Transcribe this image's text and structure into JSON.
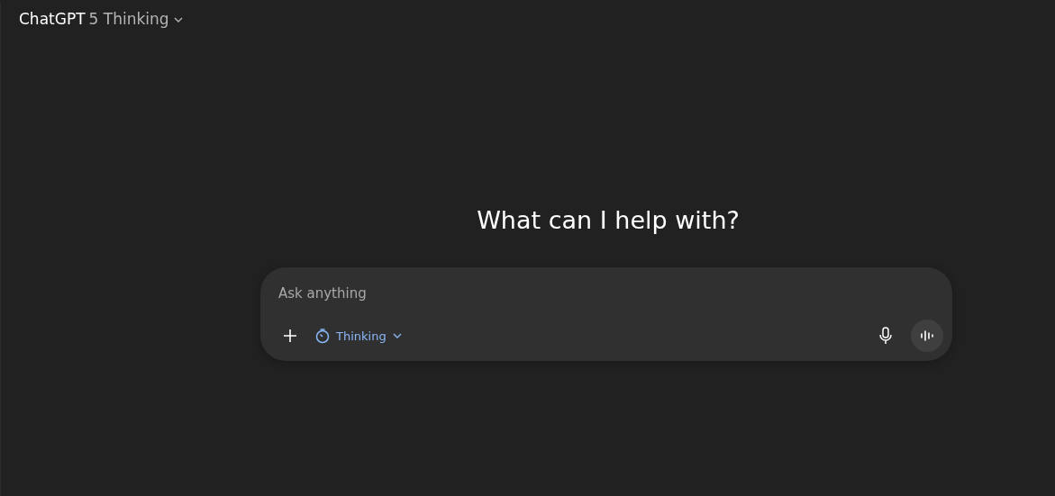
{
  "model_selector": {
    "name": "ChatGPT",
    "version": "5 Thinking"
  },
  "heading": "What can I help with?",
  "composer": {
    "placeholder": "Ask anything",
    "mode": "Thinking"
  }
}
